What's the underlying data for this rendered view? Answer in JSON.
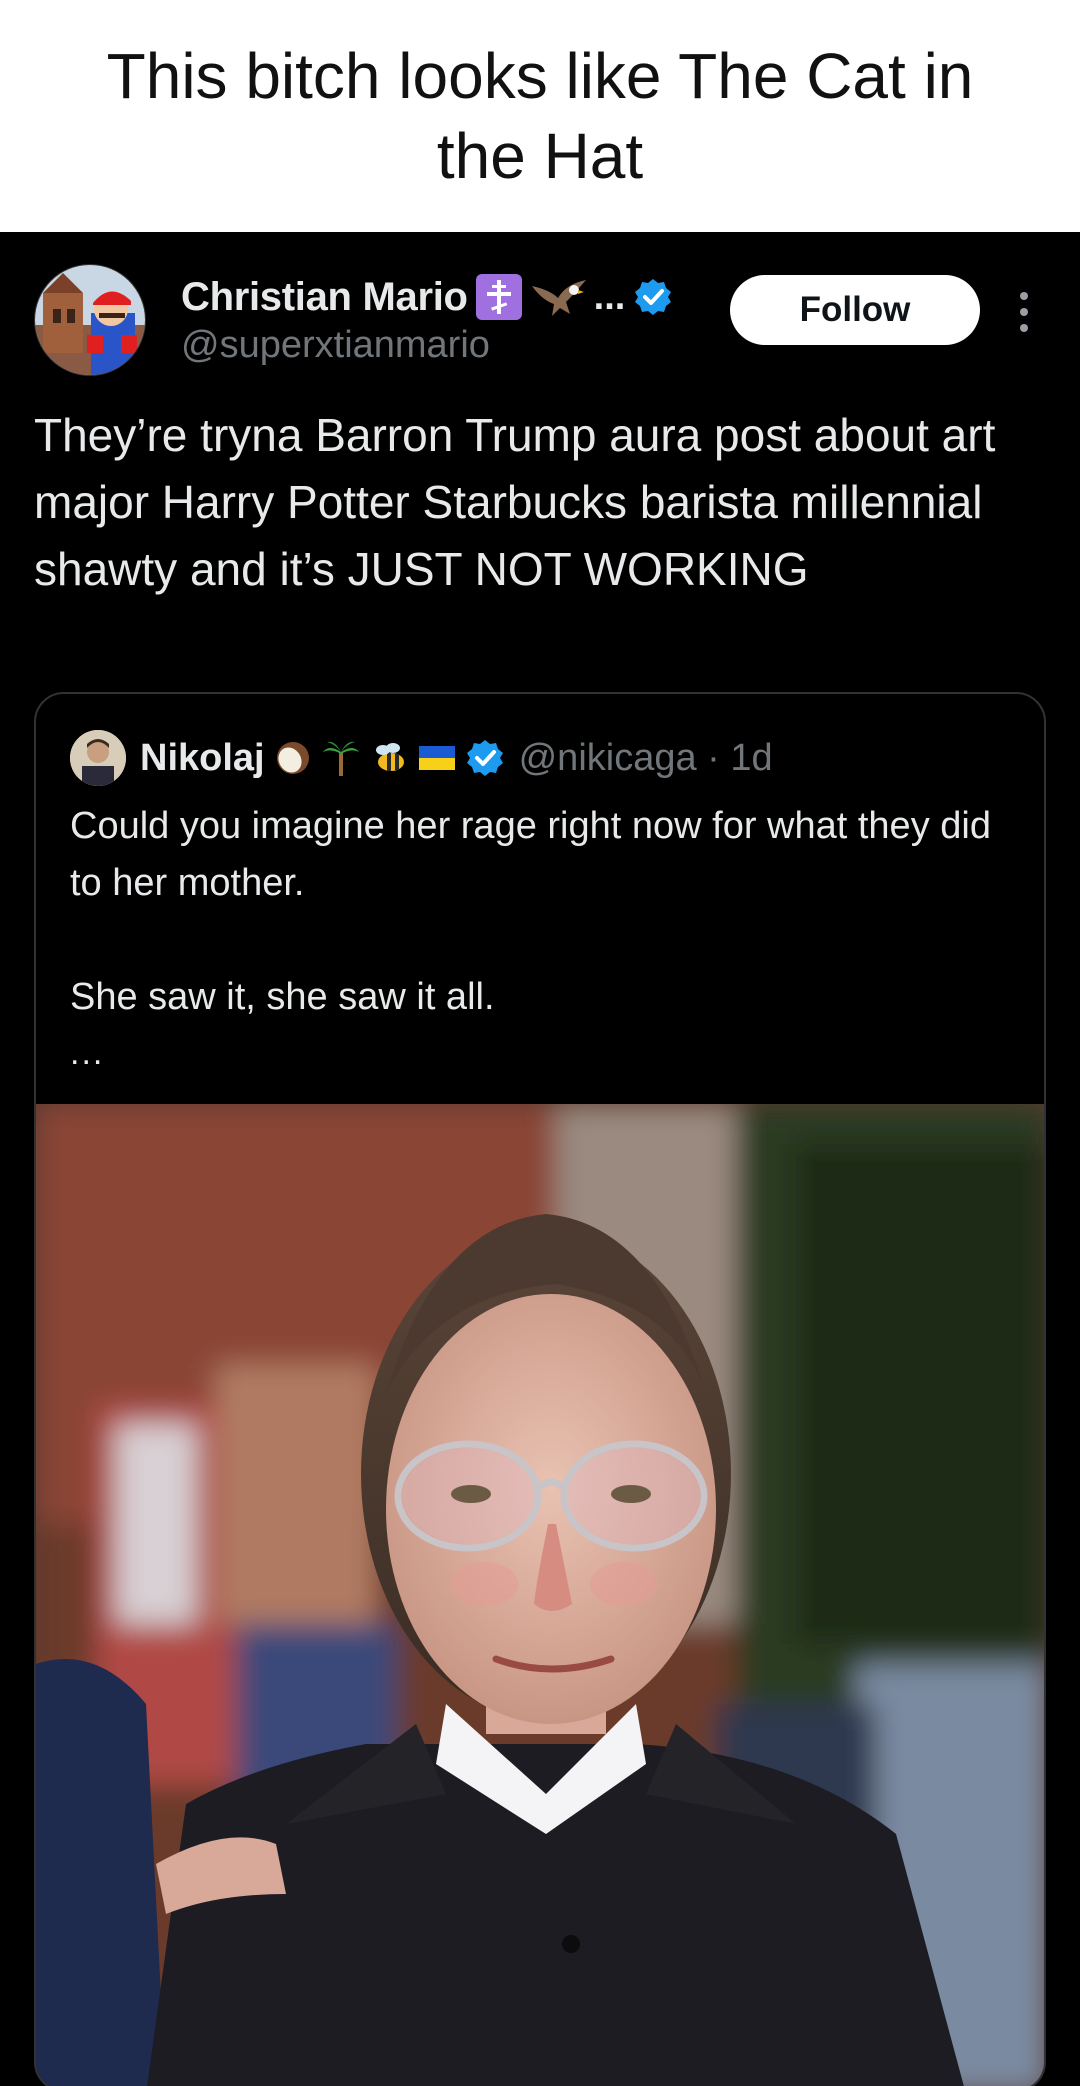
{
  "caption": {
    "text": "This bitch looks like The Cat in the Hat"
  },
  "tweet": {
    "author": {
      "display_name": "Christian Mario",
      "badges": [
        "orthodox-cross-emoji",
        "eagle-emoji"
      ],
      "truncation": "...",
      "verified": true,
      "handle": "@superxtianmario"
    },
    "follow_label": "Follow",
    "text": "They’re tryna Barron Trump aura post about art major Harry Potter Starbucks barista millennial shawty and it’s JUST NOT WORKING",
    "quoted_tweet": {
      "display_name": "Nikolaj",
      "emojis": [
        "coconut-emoji",
        "palm-tree-emoji",
        "bee-emoji",
        "ukraine-flag-emoji"
      ],
      "verified": true,
      "handle_time": "@nikicaga · 1d",
      "text": "Could you imagine her rage right now for what they did to her mother.\n\nShe saw it, she saw it all.",
      "more_indicator": "...",
      "photo": "crying-woman-photo"
    }
  },
  "colors": {
    "tweet_bg": "#000000",
    "text_primary": "#e7e9ea",
    "text_secondary": "#71767b",
    "verified_blue": "#1d9bf0",
    "border": "#2f3336"
  }
}
